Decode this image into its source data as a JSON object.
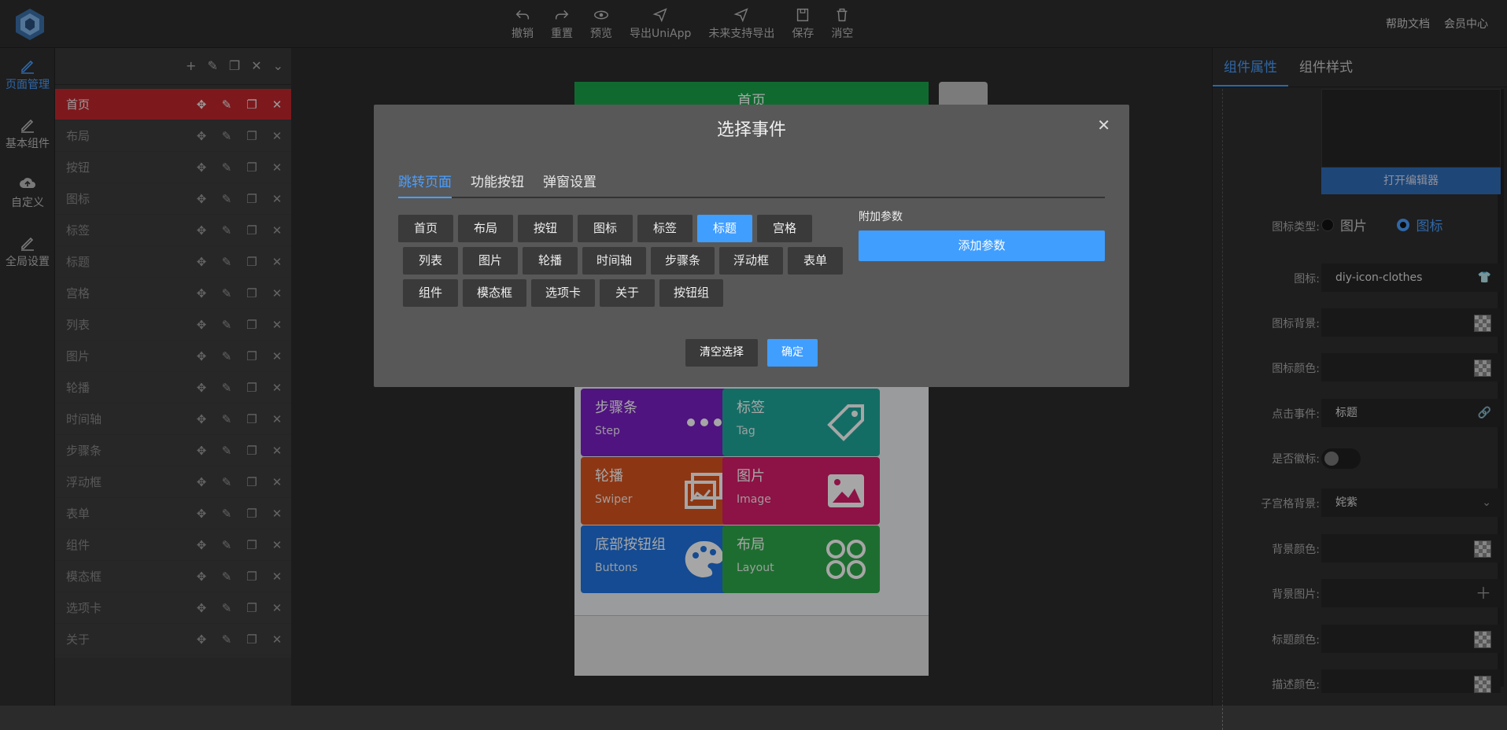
{
  "toolbar": {
    "undo": "撤销",
    "reset": "重置",
    "preview": "预览",
    "export_uniapp": "导出UniApp",
    "export_future": "未来支持导出",
    "save": "保存",
    "clear": "消空"
  },
  "toplinks": {
    "help": "帮助文档",
    "member": "会员中心"
  },
  "leftnav": {
    "items": [
      {
        "label": "页面管理"
      },
      {
        "label": "基本组件"
      },
      {
        "label": "自定义"
      },
      {
        "label": "全局设置"
      }
    ]
  },
  "pages": {
    "items": [
      {
        "label": "首页"
      },
      {
        "label": "布局"
      },
      {
        "label": "按钮"
      },
      {
        "label": "图标"
      },
      {
        "label": "标签"
      },
      {
        "label": "标题"
      },
      {
        "label": "宫格"
      },
      {
        "label": "列表"
      },
      {
        "label": "图片"
      },
      {
        "label": "轮播"
      },
      {
        "label": "时间轴"
      },
      {
        "label": "步骤条"
      },
      {
        "label": "浮动框"
      },
      {
        "label": "表单"
      },
      {
        "label": "组件"
      },
      {
        "label": "模态框"
      },
      {
        "label": "选项卡"
      },
      {
        "label": "关于"
      }
    ]
  },
  "phone": {
    "title": "首页",
    "tiles": [
      {
        "title": "步骤条",
        "sub": "Step",
        "color": "#7a1fc4"
      },
      {
        "title": "标签",
        "sub": "Tag",
        "color": "#1fa89b"
      },
      {
        "title": "轮播",
        "sub": "Swiper",
        "color": "#d9531e"
      },
      {
        "title": "图片",
        "sub": "Image",
        "color": "#d91c6a"
      },
      {
        "title": "底部按钮组",
        "sub": "Buttons",
        "color": "#1f73e0"
      },
      {
        "title": "布局",
        "sub": "Layout",
        "color": "#2fa84a"
      }
    ]
  },
  "modal": {
    "title": "选择事件",
    "tabs": [
      {
        "label": "跳转页面"
      },
      {
        "label": "功能按钮"
      },
      {
        "label": "弹窗设置"
      }
    ],
    "chips_row1": [
      "首页",
      "布局",
      "按钮",
      "图标",
      "标签",
      "标题",
      "宫格"
    ],
    "chips_row2": [
      "列表",
      "图片",
      "轮播",
      "时间轴",
      "步骤条",
      "浮动框",
      "表单"
    ],
    "chips_row3": [
      "组件",
      "模态框",
      "选项卡",
      "关于",
      "按钮组"
    ],
    "selected": "标题",
    "extra_label": "附加参数",
    "add_param": "添加参数",
    "clear_selection": "清空选择",
    "confirm": "确定"
  },
  "rpanel": {
    "tabs": [
      {
        "label": "组件属性"
      },
      {
        "label": "组件样式"
      }
    ],
    "open_editor": "打开编辑器",
    "icon_type_label": "图标类型:",
    "icon_type_image": "图片",
    "icon_type_icon": "图标",
    "icon_label": "图标:",
    "icon_value": "diy-icon-clothes",
    "icon_bg_label": "图标背景:",
    "icon_color_label": "图标颜色:",
    "click_event_label": "点击事件:",
    "click_event_value": "标题",
    "badge_label": "是否徽标:",
    "sub_bg_label": "子宫格背景:",
    "sub_bg_value": "姹紫",
    "bg_color_label": "背景颜色:",
    "bg_image_label": "背景图片:",
    "title_color_label": "标题颜色:",
    "desc_color_label": "描述颜色:"
  }
}
